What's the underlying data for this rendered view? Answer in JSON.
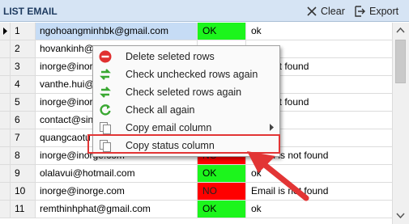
{
  "header": {
    "title": "LIST EMAIL",
    "clear_label": "Clear",
    "export_label": "Export"
  },
  "rows": [
    {
      "num": "1",
      "email": "ngohoangminhbk@gmail.com",
      "status": "OK",
      "result": "ok"
    },
    {
      "num": "2",
      "email": "hovankinh@",
      "status": "",
      "result": ""
    },
    {
      "num": "3",
      "email": "inorge@inor",
      "status": "",
      "result": "s is not found"
    },
    {
      "num": "4",
      "email": "vanthe.hui@",
      "status": "",
      "result": ""
    },
    {
      "num": "5",
      "email": "inorge@inor",
      "status": "",
      "result": "s is not found"
    },
    {
      "num": "6",
      "email": "contact@sin",
      "status": "",
      "result": ""
    },
    {
      "num": "7",
      "email": "quangcaotu",
      "status": "",
      "result": ""
    },
    {
      "num": "8",
      "email": "inorge@inorge.com",
      "status": "NO",
      "result": "Email is not found"
    },
    {
      "num": "9",
      "email": "olalavui@hotmail.com",
      "status": "OK",
      "result": "ok"
    },
    {
      "num": "10",
      "email": "inorge@inorge.com",
      "status": "NO",
      "result": "Email is not found"
    },
    {
      "num": "11",
      "email": "remthinhphat@gmail.com",
      "status": "OK",
      "result": "ok"
    }
  ],
  "menu": {
    "items": [
      {
        "label": "Delete seleted rows",
        "icon": "delete-icon"
      },
      {
        "label": "Check unchecked rows again",
        "icon": "refresh-icon"
      },
      {
        "label": "Check seleted rows again",
        "icon": "refresh-icon"
      },
      {
        "label": "Check all again",
        "icon": "refresh-icon"
      },
      {
        "label": "Copy email column",
        "icon": "copy-icon"
      },
      {
        "label": "Copy status column",
        "icon": "copy-icon"
      }
    ]
  },
  "colors": {
    "ok": "#1cf51c",
    "no": "#ff0000",
    "highlight": "#e23535",
    "header_bg": "#d6e4f4"
  }
}
